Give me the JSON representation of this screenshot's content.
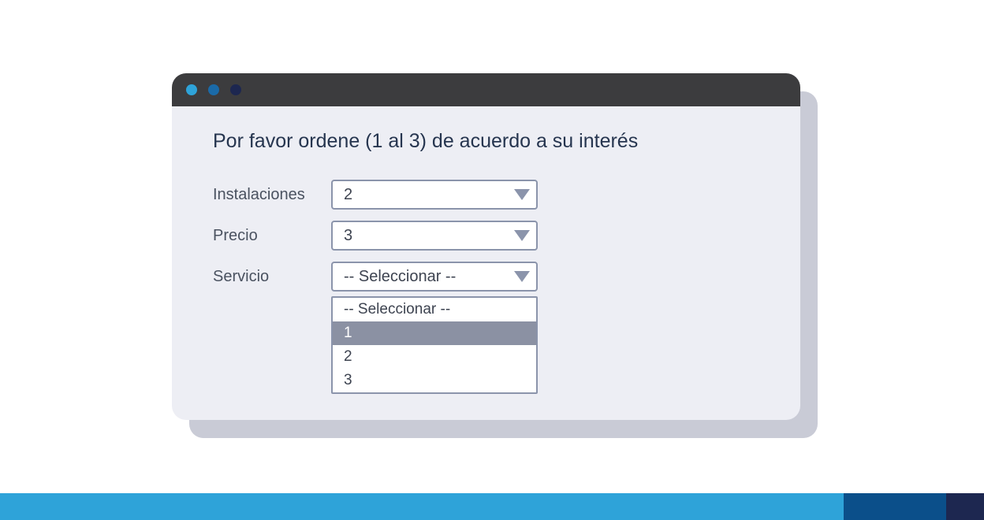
{
  "heading": "Por favor ordene (1 al 3) de acuerdo a su interés",
  "rows": [
    {
      "label": "Instalaciones",
      "value": "2"
    },
    {
      "label": "Precio",
      "value": "3"
    },
    {
      "label": "Servicio",
      "value": "-- Seleccionar --"
    }
  ],
  "dropdown": {
    "options": [
      "-- Seleccionar --",
      "1",
      "2",
      "3"
    ],
    "hover_index": 1
  }
}
